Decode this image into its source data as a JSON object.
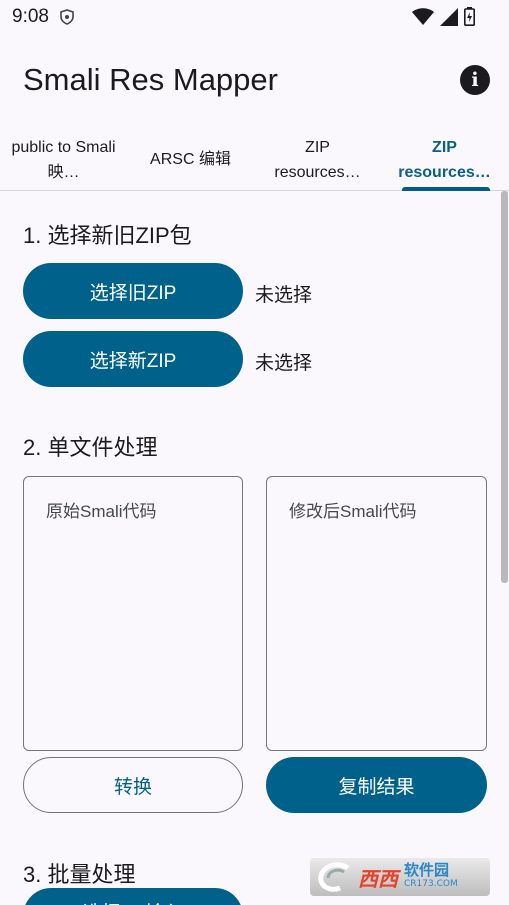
{
  "status_bar": {
    "time": "9:08"
  },
  "app": {
    "title": "Smali Res Mapper"
  },
  "tabs": [
    {
      "label": "public to Smali 映…"
    },
    {
      "label": "ARSC 编辑"
    },
    {
      "label": "ZIP resources…"
    },
    {
      "label": "ZIP resources…"
    }
  ],
  "section1": {
    "title": "1. 选择新旧ZIP包",
    "old_zip_button": "选择旧ZIP",
    "old_zip_status": "未选择",
    "new_zip_button": "选择新ZIP",
    "new_zip_status": "未选择"
  },
  "section2": {
    "title": "2. 单文件处理",
    "original_placeholder": "原始Smali代码",
    "modified_placeholder": "修改后Smali代码",
    "convert_button": "转换",
    "copy_button": "复制结果"
  },
  "section3": {
    "title": "3. 批量处理",
    "partial_button": "选择… 输入"
  },
  "watermark": {
    "main": "西西",
    "line1": "软件园",
    "line2": "CR173.COM"
  },
  "colors": {
    "primary": "#00628b",
    "background": "#fbf8fd"
  }
}
